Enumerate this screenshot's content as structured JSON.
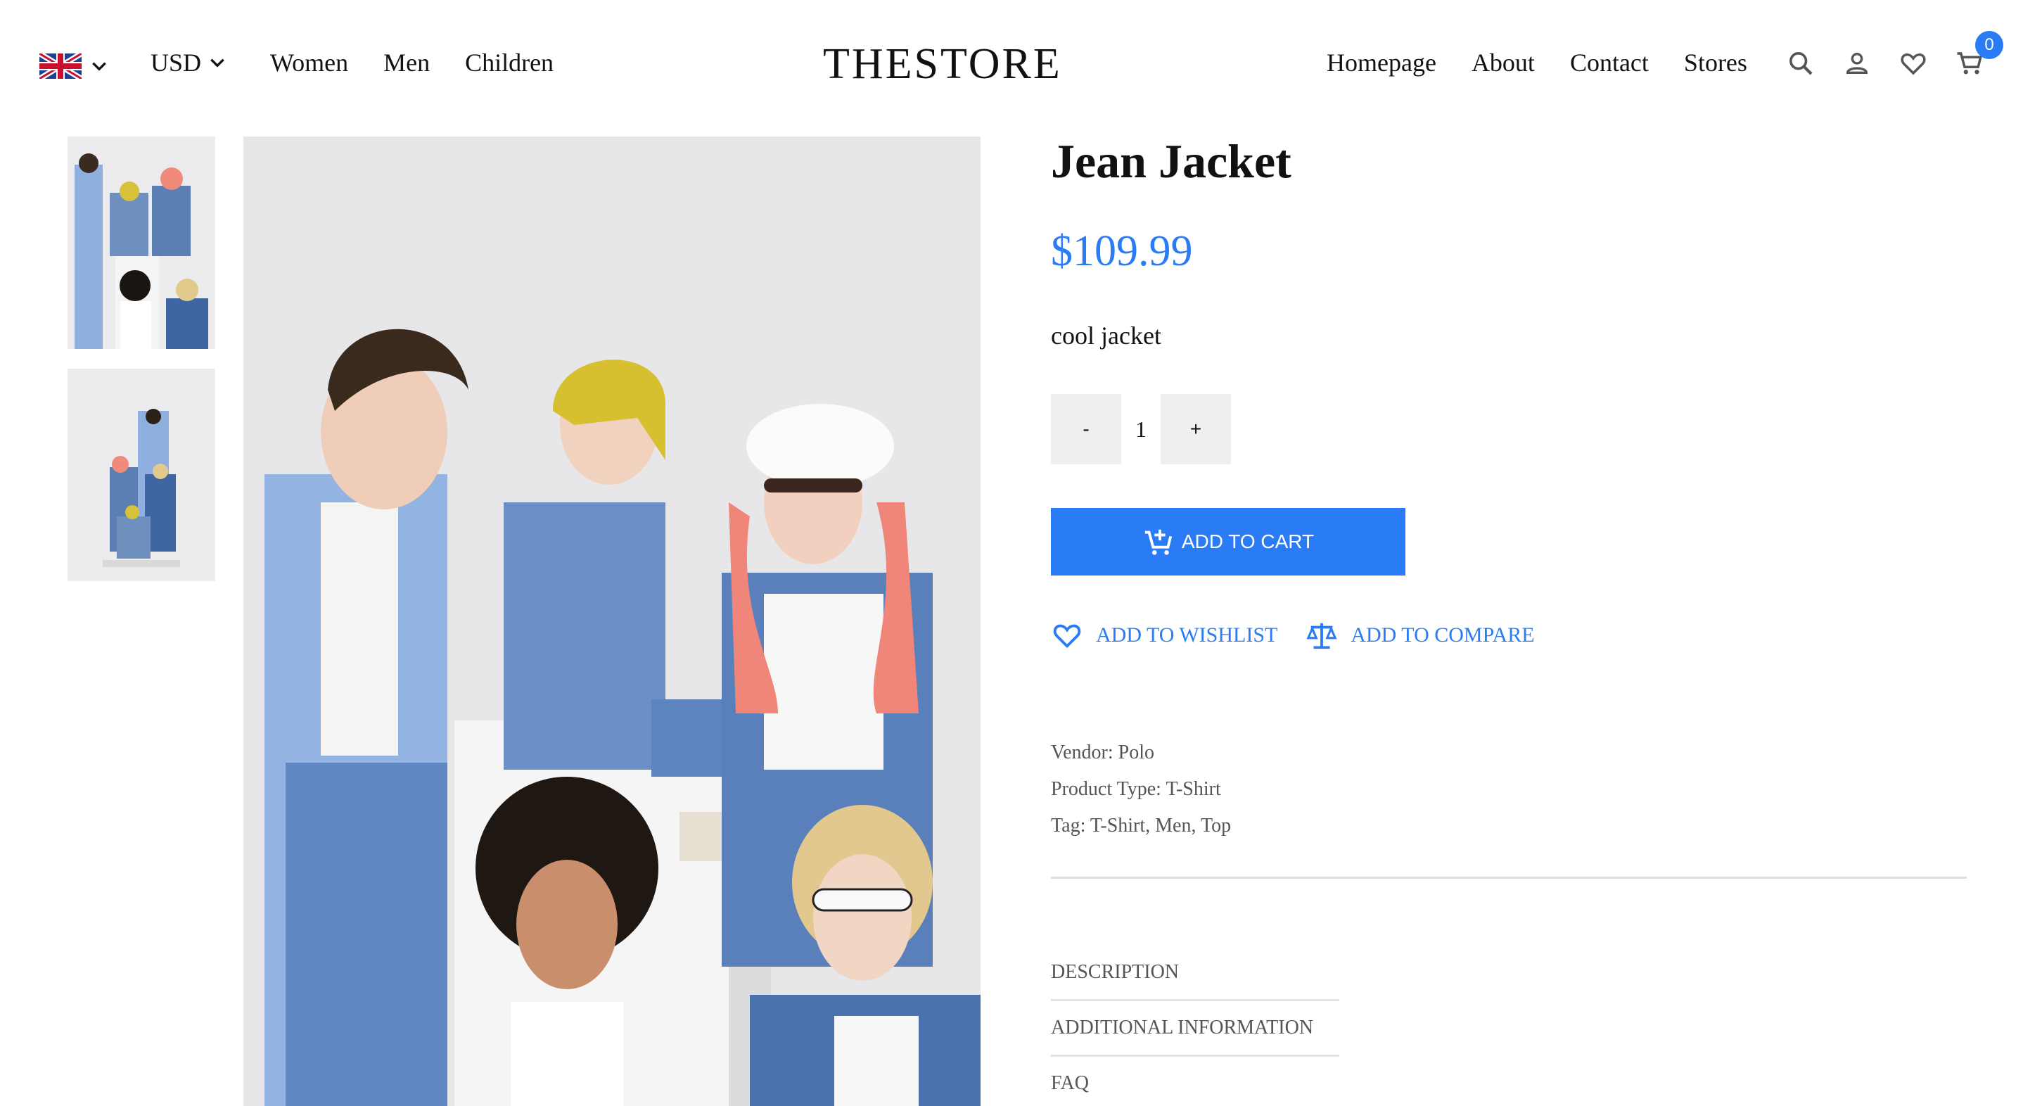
{
  "header": {
    "flag_icon": "uk-flag-icon",
    "currency": "USD",
    "nav_left": [
      "Women",
      "Men",
      "Children"
    ],
    "logo": "THESTORE",
    "nav_right": [
      "Homepage",
      "About",
      "Contact",
      "Stores"
    ],
    "icons": [
      "search-icon",
      "user-icon",
      "heart-icon",
      "cart-icon"
    ],
    "cart_count": "0"
  },
  "product": {
    "title": "Jean Jacket",
    "price": "$109.99",
    "description": "cool jacket",
    "quantity": "1",
    "qty_minus": "-",
    "qty_plus": "+",
    "add_to_cart": "ADD TO CART",
    "add_to_wishlist": "ADD TO WISHLIST",
    "add_to_compare": "ADD TO COMPARE",
    "vendor": "Vendor: Polo",
    "product_type": "Product Type: T-Shirt",
    "tag": "Tag: T-Shirt, Men, Top",
    "tabs": [
      "DESCRIPTION",
      "ADDITIONAL INFORMATION",
      "FAQ"
    ]
  },
  "colors": {
    "accent": "#2a7cf6",
    "qty_button_bg": "#efefef",
    "text": "#111111",
    "muted_text": "#555555"
  }
}
